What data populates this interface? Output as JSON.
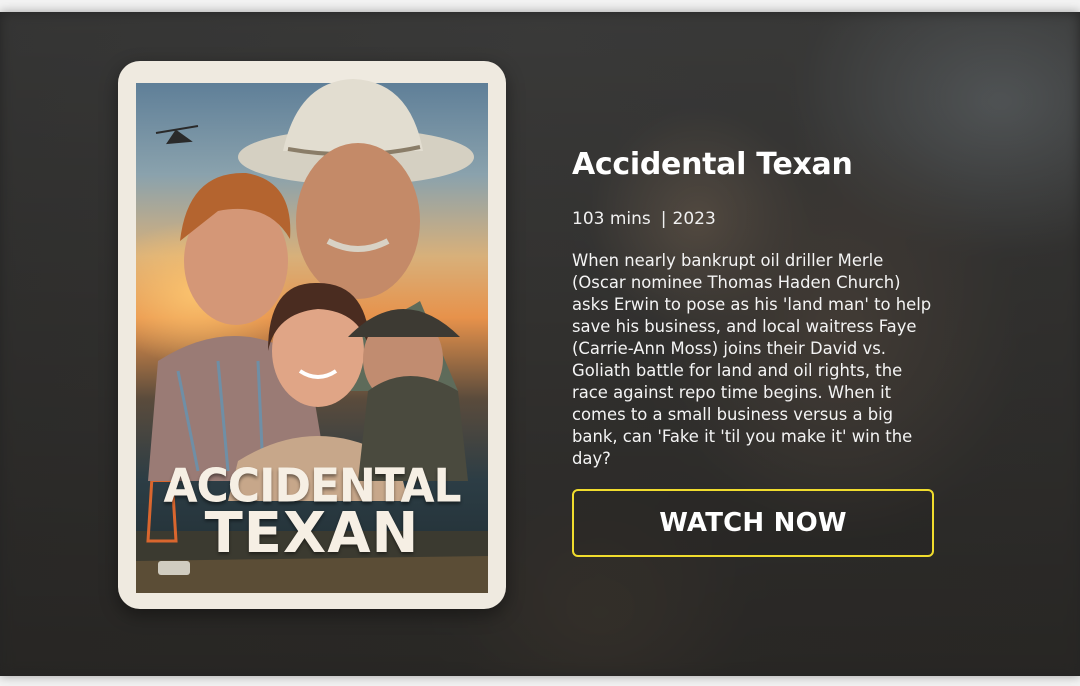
{
  "movie": {
    "title": "Accidental Texan",
    "duration": "103 mins",
    "separator": "|",
    "year": "2023",
    "description": "When nearly bankrupt oil driller Merle (Oscar nominee Thomas Haden Church) asks Erwin to pose as his 'land man' to help save his business, and local waitress Faye (Carrie-Ann Moss) joins their David vs. Goliath battle for land and oil rights, the race against repo time begins. When it comes to a small business versus a big bank, can 'Fake it 'til you make it' win the day?"
  },
  "poster": {
    "title_line1": "ACCIDENTAL",
    "title_line2": "TEXAN"
  },
  "cta": {
    "label": "WATCH NOW",
    "border_color": "#f0dc2d"
  }
}
